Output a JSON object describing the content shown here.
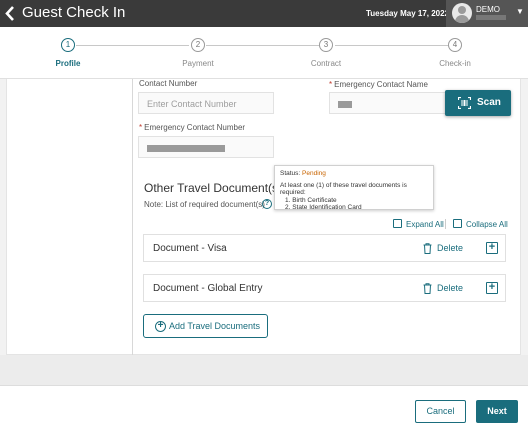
{
  "header": {
    "title": "Guest Check In",
    "date": "Tuesday May 17, 2022",
    "user": "DEMO"
  },
  "stepper": {
    "steps": [
      {
        "number": "1",
        "label": "Profile"
      },
      {
        "number": "2",
        "label": "Payment"
      },
      {
        "number": "3",
        "label": "Contract"
      },
      {
        "number": "4",
        "label": "Check-in"
      }
    ],
    "active_step": 1
  },
  "form": {
    "contact_number": {
      "label": "Contact Number",
      "placeholder": "Enter Contact Number"
    },
    "emergency_contact_name": {
      "label": "Emergency Contact Name",
      "required_mark": "*"
    },
    "emergency_contact_number": {
      "label": "Emergency Contact Number",
      "required_mark": "*"
    },
    "scan_label": "Scan"
  },
  "travel_docs": {
    "title": "Other Travel Document(s)",
    "note": "Note: List of required document(s)",
    "tooltip": {
      "status_label": "Status:",
      "status_value": "Pending",
      "message": "At least one (1) of these travel documents is required:",
      "items": [
        "1. Birth Certificate",
        "2. State Identification Card"
      ]
    },
    "expand_all": "Expand All",
    "collapse_all": "Collapse All",
    "documents": [
      {
        "title": "Document - Visa",
        "delete_label": "Delete"
      },
      {
        "title": "Document - Global Entry",
        "delete_label": "Delete"
      }
    ],
    "add_label": "Add Travel Documents"
  },
  "footer": {
    "cancel": "Cancel",
    "next": "Next"
  },
  "colors": {
    "accent": "#1a6d7d",
    "header_bg": "#3a3a3a",
    "required": "#c0392b",
    "pending": "#c86400"
  }
}
